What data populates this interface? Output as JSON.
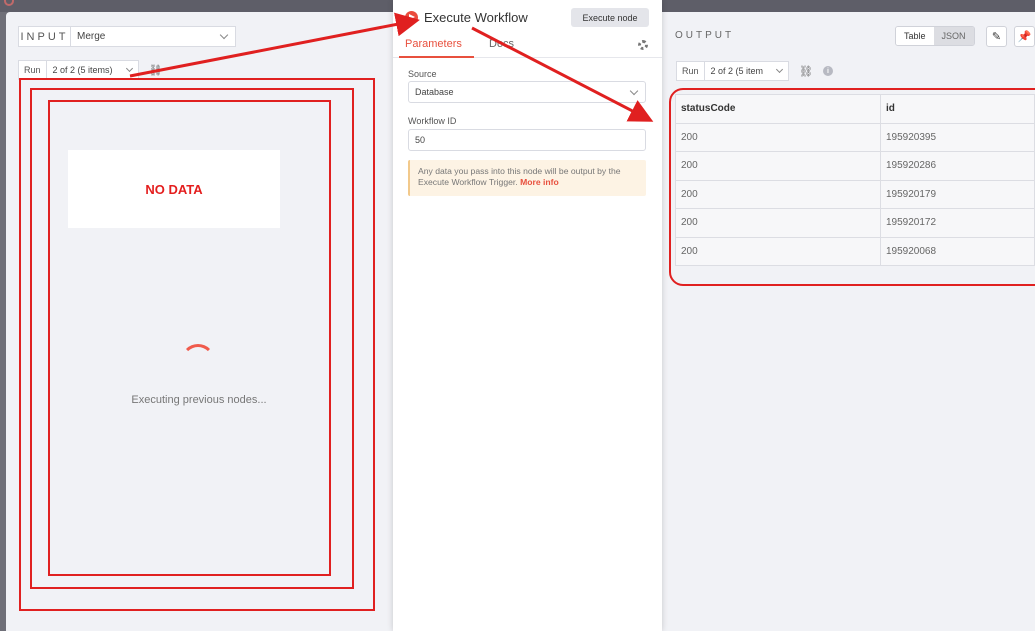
{
  "input": {
    "tag": "INPUT",
    "node_select": "Merge",
    "run_label": "Run",
    "run_select": "2 of 2 (5 items)",
    "no_data": "NO DATA",
    "executing": "Executing previous nodes..."
  },
  "center": {
    "title": "Execute Workflow",
    "execute_button": "Execute node",
    "tabs": [
      "Parameters",
      "Docs"
    ],
    "source_label": "Source",
    "source_value": "Database",
    "workflow_id_label": "Workflow ID",
    "workflow_id_value": "50",
    "notice_text": "Any data you pass into this node will be output by the Execute Workflow Trigger.",
    "notice_link": "More info"
  },
  "output": {
    "title": "OUTPUT",
    "view_table": "Table",
    "view_json": "JSON",
    "run_label": "Run",
    "run_select": "2 of 2 (5 item",
    "columns": [
      "statusCode",
      "id"
    ],
    "rows": [
      [
        "200",
        "195920395"
      ],
      [
        "200",
        "195920286"
      ],
      [
        "200",
        "195920179"
      ],
      [
        "200",
        "195920172"
      ],
      [
        "200",
        "195920068"
      ]
    ]
  },
  "colors": {
    "accent": "#e8503e",
    "annotation_red": "#e02020"
  },
  "icons": {
    "pencil": "pencil-icon",
    "pin": "pin-icon",
    "gear": "gear-icon",
    "link_off": "unlink-icon",
    "info": "info-icon",
    "workflow": "execute-workflow-icon"
  }
}
